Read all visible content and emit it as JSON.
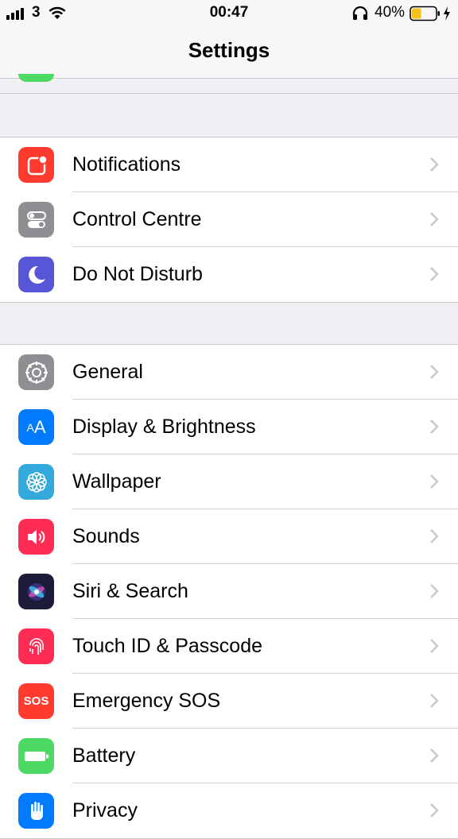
{
  "status_bar": {
    "carrier": "3",
    "time": "00:47",
    "battery_percent": "40%",
    "battery_level": 0.4,
    "battery_color": "#f4c21b"
  },
  "nav": {
    "title": "Settings"
  },
  "groups": [
    {
      "rows": [
        {
          "label": "Notifications",
          "icon": "notifications-icon",
          "color": "#ff3b30"
        },
        {
          "label": "Control Centre",
          "icon": "control-centre-icon",
          "color": "#8e8e93"
        },
        {
          "label": "Do Not Disturb",
          "icon": "moon-icon",
          "color": "#5856d6"
        }
      ]
    },
    {
      "rows": [
        {
          "label": "General",
          "icon": "gear-icon",
          "color": "#8e8e93"
        },
        {
          "label": "Display & Brightness",
          "icon": "display-icon",
          "color": "#007aff"
        },
        {
          "label": "Wallpaper",
          "icon": "wallpaper-icon",
          "color": "#34aadc"
        },
        {
          "label": "Sounds",
          "icon": "speaker-icon",
          "color": "#ff2d55"
        },
        {
          "label": "Siri & Search",
          "icon": "siri-icon",
          "color": "#1c1c3a"
        },
        {
          "label": "Touch ID & Passcode",
          "icon": "fingerprint-icon",
          "color": "#ff2d55"
        },
        {
          "label": "Emergency SOS",
          "icon": "sos-icon",
          "color": "#ff3b30",
          "icon_text": "SOS"
        },
        {
          "label": "Battery",
          "icon": "battery-icon",
          "color": "#4cd964"
        },
        {
          "label": "Privacy",
          "icon": "hand-icon",
          "color": "#007aff"
        }
      ]
    }
  ]
}
